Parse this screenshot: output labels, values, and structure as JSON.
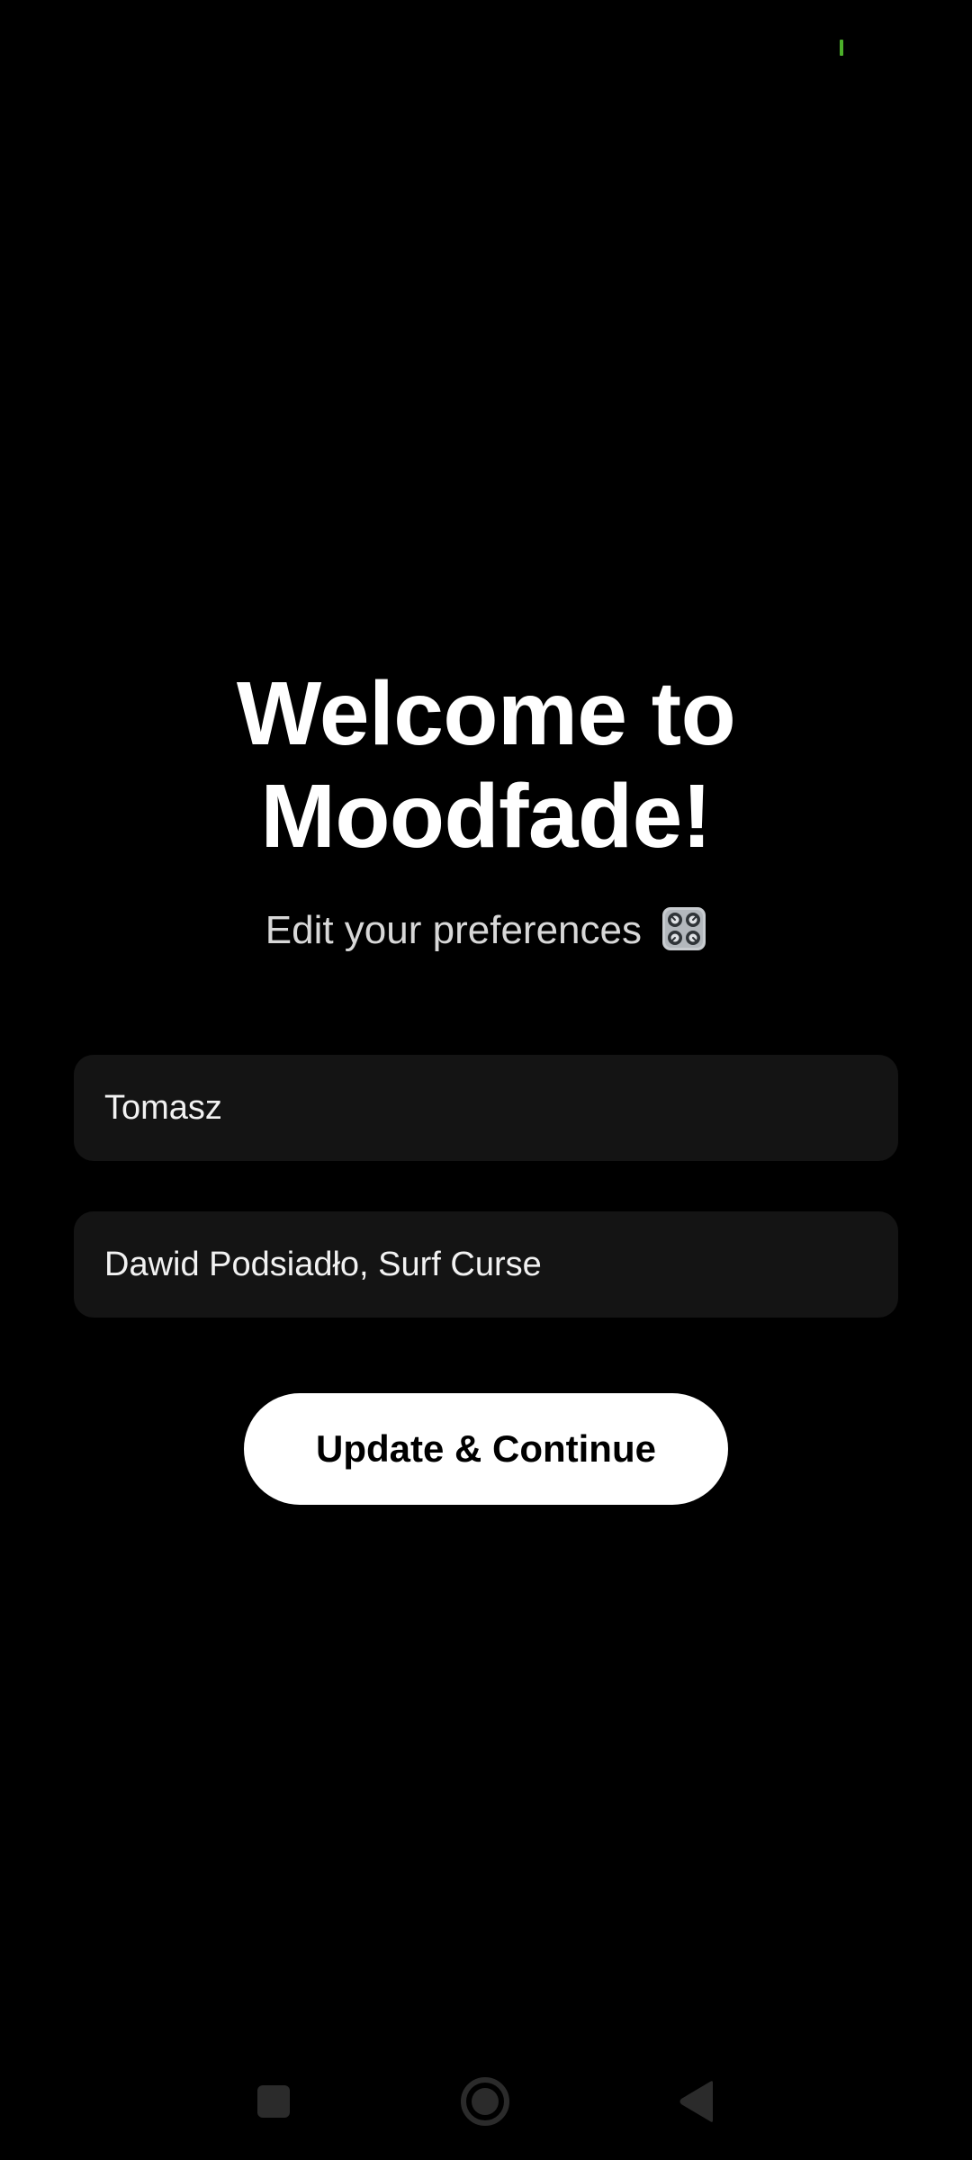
{
  "status_bar": {
    "indicator_color": "#4caf2a"
  },
  "onboarding": {
    "title_line1": "Welcome to",
    "title_line2": "Moodfade!",
    "subtitle": "Edit your preferences",
    "subtitle_icon": "control-knobs-icon"
  },
  "form": {
    "name_value": "Tomasz",
    "artists_value": "Dawid Podsiadło, Surf Curse"
  },
  "actions": {
    "continue_label": "Update & Continue"
  },
  "nav_bar": {
    "recents_icon": "square-icon",
    "home_icon": "circle-icon",
    "back_icon": "triangle-back-icon"
  },
  "colors": {
    "background": "#000000",
    "field_background": "#141414",
    "button_background": "#ffffff",
    "text_primary": "#ffffff",
    "text_secondary": "#d8d8d8",
    "nav_icon": "#2b2b2b"
  }
}
